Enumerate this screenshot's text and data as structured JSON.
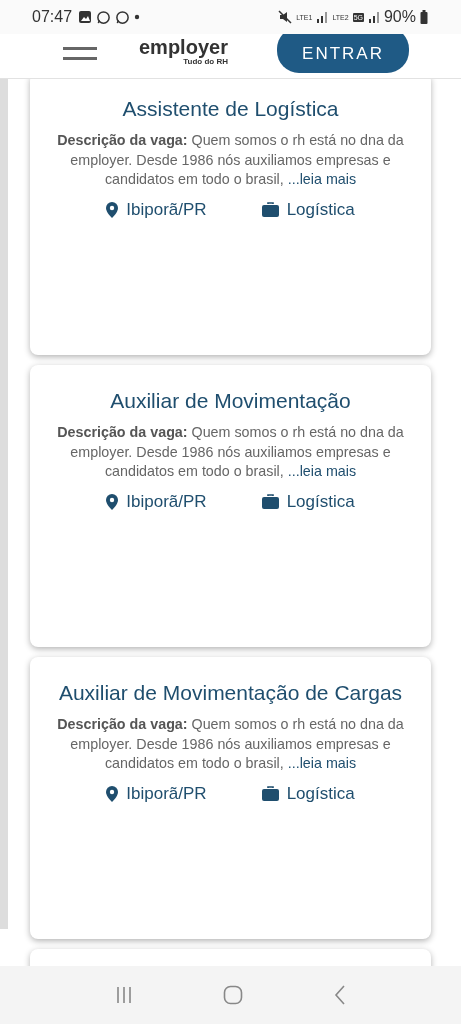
{
  "status_bar": {
    "time": "07:47",
    "network_1": "LTE1",
    "network_2": "LTE2",
    "network_3": "5G",
    "battery": "90%"
  },
  "header": {
    "logo": "employer",
    "tagline": "Tudo do RH",
    "login_button": "ENTRAR"
  },
  "jobs": [
    {
      "title": "Assistente de Logística",
      "description": "**Descrição da vaga:** Quem somos o rh está no dna da employer. Desde 1986 nós auxiliamos empresas e candidatos em todo o brasil,",
      "more_link": "...leia mais",
      "location": "Ibiporã/PR",
      "category": "Logística"
    },
    {
      "title": "Auxiliar de Movimentação",
      "description": "**Descrição da vaga:** Quem somos o rh está no dna da employer. Desde 1986 nós auxiliamos empresas e candidatos em todo o brasil,",
      "more_link": "...leia mais",
      "location": "Ibiporã/PR",
      "category": "Logística"
    },
    {
      "title": "Auxiliar de Movimentação de Cargas",
      "description": "**Descrição da vaga:** Quem somos o rh está no dna da employer. Desde 1986 nós auxiliamos empresas e candidatos em todo o brasil,",
      "more_link": "...leia mais",
      "location": "Ibiporã/PR",
      "category": "Logística"
    }
  ]
}
